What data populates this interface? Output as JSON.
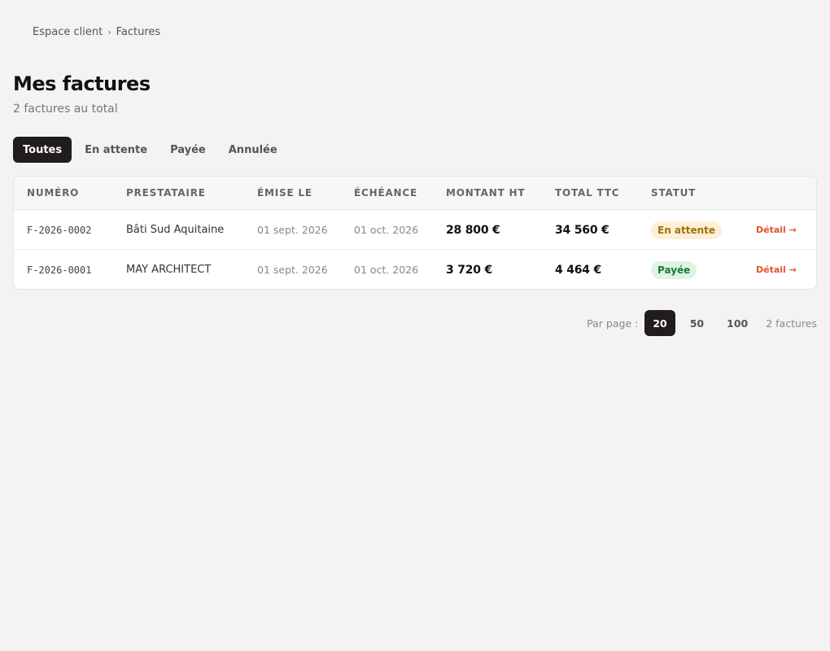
{
  "breadcrumb": {
    "parent": "Espace client",
    "separator": "›",
    "current": "Factures"
  },
  "header": {
    "title": "Mes factures",
    "subtitle": "2 factures au total"
  },
  "tabs": [
    {
      "label": "Toutes",
      "active": true
    },
    {
      "label": "En attente",
      "active": false
    },
    {
      "label": "Payée",
      "active": false
    },
    {
      "label": "Annulée",
      "active": false
    }
  ],
  "table": {
    "columns": [
      "NUMÉRO",
      "PRESTATAIRE",
      "ÉMISE LE",
      "ÉCHÉANCE",
      "MONTANT HT",
      "TOTAL TTC",
      "STATUT"
    ],
    "rows": [
      {
        "numero": "F-2026-0002",
        "prestataire": "Bâti Sud Aquitaine",
        "emise": "01 sept. 2026",
        "echeance": "01 oct. 2026",
        "montant_ht": "28 800 €",
        "total_ttc": "34 560 €",
        "statut": "En attente",
        "statut_color": "#a4700a",
        "detail": "Détail →"
      },
      {
        "numero": "F-2026-0001",
        "prestataire": "MAY ARCHITECT",
        "emise": "01 sept. 2026",
        "echeance": "01 oct. 2026",
        "montant_ht": "3 720 €",
        "total_ttc": "4 464 €",
        "statut": "Payée",
        "statut_color": "#1b7a33",
        "detail": "Détail →"
      }
    ]
  },
  "pagination": {
    "label": "Par page :",
    "options": [
      {
        "label": "20",
        "active": true
      },
      {
        "label": "50",
        "active": false
      },
      {
        "label": "100",
        "active": false
      }
    ],
    "count": "2 factures"
  },
  "colors": {
    "accent": "#e0542e",
    "dark": "#211d1d",
    "background": "#f3f3f3"
  }
}
